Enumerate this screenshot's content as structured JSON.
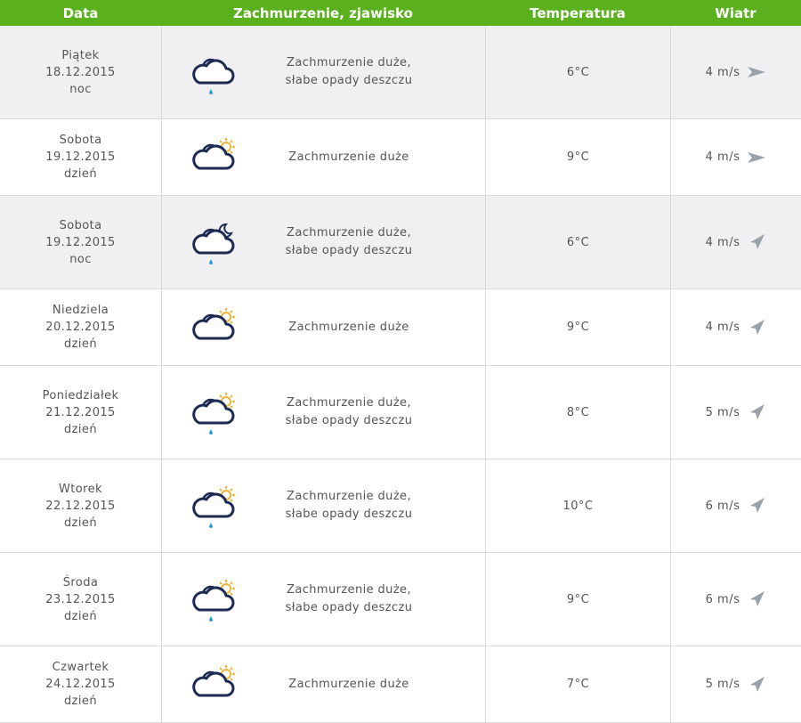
{
  "header": {
    "date": "Data",
    "condition": "Zachmurzenie, zjawisko",
    "temperature": "Temperatura",
    "wind": "Wiatr"
  },
  "colors": {
    "header_bg": "#5bb11d",
    "shaded_row": "#f0f0f2",
    "icon_cloud": "#1d2a52",
    "icon_sun": "#f2b43a",
    "icon_rain": "#2e9bd6"
  },
  "rows": [
    {
      "day": "Piątek",
      "date": "18.12.2015",
      "period": "noc",
      "icon": "cloud-rain-night-icon",
      "cond1": "Zachmurzenie duże,",
      "cond2": "słabe opady deszczu",
      "temp": "6°C",
      "wind": "4 m/s"
    },
    {
      "day": "Sobota",
      "date": "19.12.2015",
      "period": "dzień",
      "icon": "cloud-sun-icon",
      "cond1": "Zachmurzenie duże",
      "cond2": "",
      "temp": "9°C",
      "wind": "4 m/s"
    },
    {
      "day": "Sobota",
      "date": "19.12.2015",
      "period": "noc",
      "icon": "cloud-moon-rain-icon",
      "cond1": "Zachmurzenie duże,",
      "cond2": "słabe opady deszczu",
      "temp": "6°C",
      "wind": "4 m/s"
    },
    {
      "day": "Niedziela",
      "date": "20.12.2015",
      "period": "dzień",
      "icon": "cloud-sun-icon",
      "cond1": "Zachmurzenie duże",
      "cond2": "",
      "temp": "9°C",
      "wind": "4 m/s"
    },
    {
      "day": "Poniedziałek",
      "date": "21.12.2015",
      "period": "dzień",
      "icon": "cloud-sun-rain-icon",
      "cond1": "Zachmurzenie duże,",
      "cond2": "słabe opady deszczu",
      "temp": "8°C",
      "wind": "5 m/s"
    },
    {
      "day": "Wtorek",
      "date": "22.12.2015",
      "period": "dzień",
      "icon": "cloud-sun-rain-icon",
      "cond1": "Zachmurzenie duże,",
      "cond2": "słabe opady deszczu",
      "temp": "10°C",
      "wind": "6 m/s"
    },
    {
      "day": "Środa",
      "date": "23.12.2015",
      "period": "dzień",
      "icon": "cloud-sun-rain-icon",
      "cond1": "Zachmurzenie duże,",
      "cond2": "słabe opady deszczu",
      "temp": "9°C",
      "wind": "6 m/s"
    },
    {
      "day": "Czwartek",
      "date": "24.12.2015",
      "period": "dzień",
      "icon": "cloud-sun-icon",
      "cond1": "Zachmurzenie duże",
      "cond2": "",
      "temp": "7°C",
      "wind": "5 m/s"
    }
  ]
}
